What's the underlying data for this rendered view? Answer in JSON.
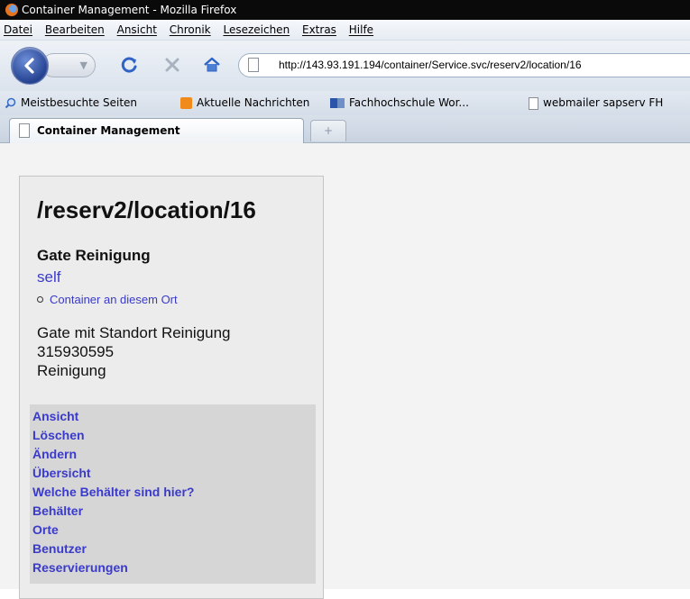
{
  "window": {
    "title": "Container Management - Mozilla Firefox"
  },
  "menubar": {
    "items": [
      "Datei",
      "Bearbeiten",
      "Ansicht",
      "Chronik",
      "Lesezeichen",
      "Extras",
      "Hilfe"
    ]
  },
  "address_bar": {
    "url": "http://143.93.191.194/container/Service.svc/reserv2/location/16"
  },
  "bookmarks": [
    {
      "label": "Meistbesuchte Seiten",
      "icon": "search-icon"
    },
    {
      "label": "Aktuelle Nachrichten",
      "icon": "rss-icon"
    },
    {
      "label": "Fachhochschule Wor...",
      "icon": "site-icon"
    },
    {
      "label": "webmailer sapserv FH",
      "icon": "page-icon"
    }
  ],
  "tabs": {
    "active": "Container Management",
    "new_tab": "+"
  },
  "page": {
    "title": "/reserv2/location/16",
    "entry_title": "Gate Reinigung",
    "self_link": "self",
    "sub_link": "Container an diesem Ort",
    "description": "Gate mit Standort Reinigung",
    "id": "315930595",
    "category": "Reinigung",
    "nav_links": [
      "Ansicht",
      "Löschen",
      "Ändern",
      "Übersicht",
      "Welche Behälter sind hier?",
      "Behälter",
      "Orte",
      "Benutzer",
      "Reservierungen"
    ]
  },
  "colors": {
    "link": "#3a3acb",
    "title_bar": "#0a0a0a",
    "nav_box": "#d6d6d6",
    "panel": "#ececec"
  }
}
